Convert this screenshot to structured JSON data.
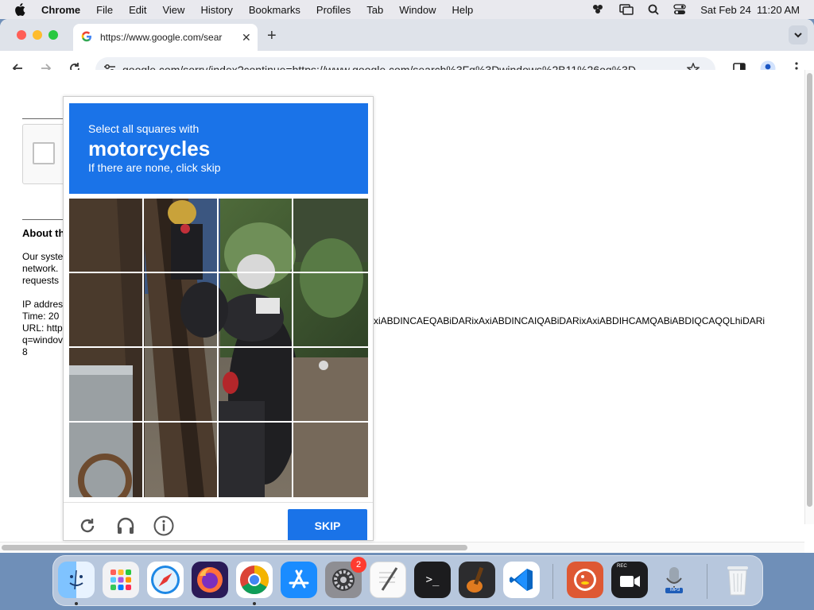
{
  "menubar": {
    "app_name": "Chrome",
    "items": [
      "File",
      "Edit",
      "View",
      "History",
      "Bookmarks",
      "Profiles",
      "Tab",
      "Window",
      "Help"
    ],
    "datetime": "Sat Feb 24  11:20 AM"
  },
  "tab": {
    "title": "https://www.google.com/sear",
    "close": "✕",
    "new_tab": "+"
  },
  "toolbar": {
    "url": "google.com/sorry/index?continue=https://www.google.com/search%3Fq%3Dwindows%2B11%26oq%3D..."
  },
  "page": {
    "about_heading": "About th",
    "body_lines": [
      "Our syste",
      "network.",
      "requests"
    ],
    "meta_lines": [
      "IP addres",
      "Time: 20",
      "URL: http",
      "q=windov",
      "8"
    ],
    "url_tail": "xiABDINCAEQABiDARixAxiABDINCAIQABiDARixAxiABDIHCAMQABiABDIQCAQQLhiDARi"
  },
  "captcha": {
    "instruction": "Select all squares with",
    "keyword": "motorcycles",
    "note": "If there are none, click skip",
    "skip_label": "SKIP",
    "accent_color": "#1a73e8",
    "tiles": 16
  },
  "dock": {
    "items": [
      "finder-icon",
      "launchpad-icon",
      "safari-icon",
      "firefox-icon",
      "chrome-icon",
      "app-store-icon",
      "system-settings-icon",
      "textedit-icon",
      "terminal-icon",
      "garageband-icon",
      "vscode-icon",
      "duckduckgo-icon",
      "screen-recorder-icon",
      "mic-icon",
      "trash-icon"
    ],
    "settings_badge": "2",
    "terminal_prompt": ">_",
    "rec_label": "REC",
    "mp3_label": "MP3"
  }
}
